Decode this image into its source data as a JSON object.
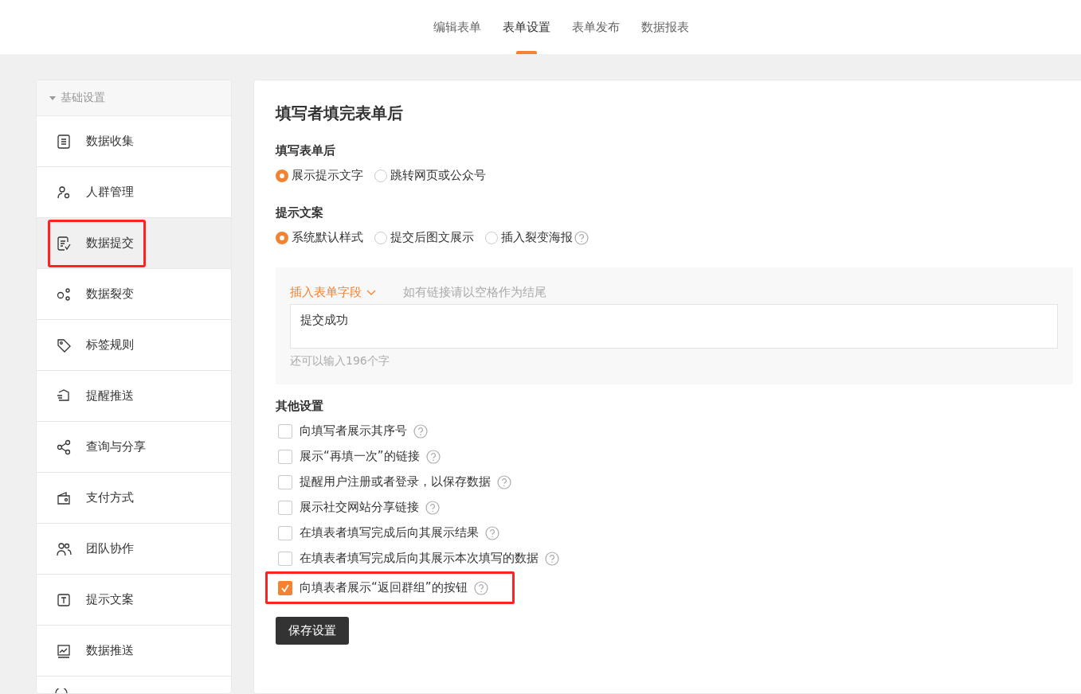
{
  "top_tabs": [
    {
      "label": "编辑表单",
      "selected": false
    },
    {
      "label": "表单设置",
      "selected": true
    },
    {
      "label": "表单发布",
      "selected": false
    },
    {
      "label": "数据报表",
      "selected": false
    }
  ],
  "sidebar": {
    "group": {
      "label": "基础设置",
      "expanded": true
    },
    "items": [
      {
        "label": "数据收集",
        "selected": false,
        "highlighted": false
      },
      {
        "label": "人群管理",
        "selected": false,
        "highlighted": false
      },
      {
        "label": "数据提交",
        "selected": true,
        "highlighted": true
      },
      {
        "label": "数据裂变",
        "selected": false,
        "highlighted": false
      },
      {
        "label": "标签规则",
        "selected": false,
        "highlighted": false
      },
      {
        "label": "提醒推送",
        "selected": false,
        "highlighted": false
      },
      {
        "label": "查询与分享",
        "selected": false,
        "highlighted": false
      },
      {
        "label": "支付方式",
        "selected": false,
        "highlighted": false
      },
      {
        "label": "团队协作",
        "selected": false,
        "highlighted": false
      },
      {
        "label": "提示文案",
        "selected": false,
        "highlighted": false
      },
      {
        "label": "数据推送",
        "selected": false,
        "highlighted": false
      }
    ]
  },
  "panel": {
    "title": "填写者填完表单后",
    "after_submit": {
      "label": "填写表单后",
      "options": [
        {
          "label": "展示提示文字",
          "selected": true,
          "help": false
        },
        {
          "label": "跳转网页或公众号",
          "selected": false,
          "help": false
        }
      ]
    },
    "prompt_copy": {
      "label": "提示文案",
      "options": [
        {
          "label": "系统默认样式",
          "selected": true,
          "help": false
        },
        {
          "label": "提交后图文展示",
          "selected": false,
          "help": false
        },
        {
          "label": "插入裂变海报",
          "selected": false,
          "help": true
        }
      ]
    },
    "editor": {
      "insert_field": "插入表单字段",
      "hint": "如有链接请以空格作为结尾",
      "value": "提交成功",
      "counter": "还可以输入196个字"
    },
    "other": {
      "label": "其他设置",
      "options": [
        {
          "label": "向填写者展示其序号",
          "checked": false,
          "help": true,
          "highlighted": false
        },
        {
          "label": "展示“再填一次”的链接",
          "checked": false,
          "help": true,
          "highlighted": false
        },
        {
          "label": "提醒用户注册或者登录，以保存数据",
          "checked": false,
          "help": true,
          "highlighted": false
        },
        {
          "label": "展示社交网站分享链接",
          "checked": false,
          "help": true,
          "highlighted": false
        },
        {
          "label": "在填表者填写完成后向其展示结果",
          "checked": false,
          "help": true,
          "highlighted": false
        },
        {
          "label": "在填表者填写完成后向其展示本次填写的数据",
          "checked": false,
          "help": true,
          "highlighted": false
        },
        {
          "label": "向填表者展示“返回群组”的按钮",
          "checked": true,
          "help": true,
          "highlighted": true
        }
      ]
    },
    "save_button": "保存设置"
  }
}
